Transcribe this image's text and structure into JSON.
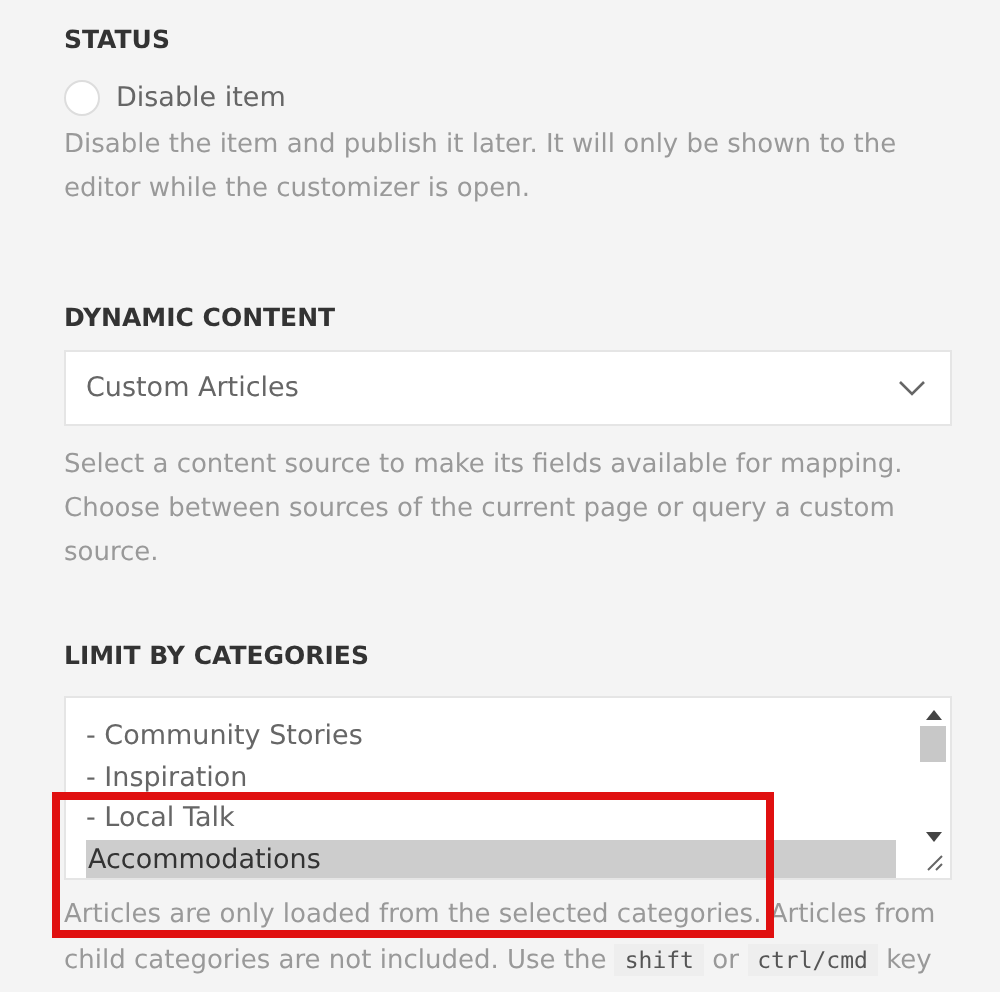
{
  "status": {
    "heading": "STATUS",
    "option": {
      "label": "Disable item",
      "checked": false
    },
    "help": "Disable the item and publish it later. It will only be shown to the editor while the customizer is open."
  },
  "dynamic_content": {
    "heading": "DYNAMIC CONTENT",
    "select": {
      "value": "Custom Articles"
    },
    "help": "Select a content source to make its fields available for mapping. Choose between sources of the current page or query a custom source."
  },
  "limit_by_categories": {
    "heading": "LIMIT BY CATEGORIES",
    "items": [
      {
        "label": "- Community Stories",
        "selected": false
      },
      {
        "label": "- Inspiration",
        "selected": false
      },
      {
        "label": "- Local Talk",
        "selected": false
      },
      {
        "label": "Accommodations",
        "selected": true
      }
    ],
    "help": [
      {
        "kind": "text",
        "text": "Articles are only loaded from the selected categories. Articles from child categories are not included. Use the "
      },
      {
        "kind": "code",
        "text": "shift"
      },
      {
        "kind": "text",
        "text": " or "
      },
      {
        "kind": "code",
        "text": "ctrl/cmd"
      },
      {
        "kind": "text",
        "text": " key"
      }
    ]
  },
  "annotation": {
    "kind": "highlight",
    "color": "#e01010"
  }
}
